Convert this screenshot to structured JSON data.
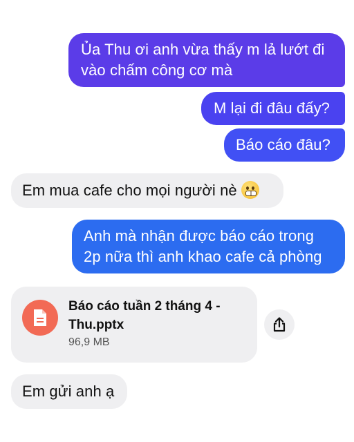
{
  "messages": [
    {
      "id": "m1",
      "direction": "outgoing",
      "text": "Ủa Thu ơi anh vừa thấy m lả lướt đi vào chấm công cơ mà"
    },
    {
      "id": "m2",
      "direction": "outgoing",
      "text": "M lại đi đâu đấy?"
    },
    {
      "id": "m3",
      "direction": "outgoing",
      "text": "Báo cáo đâu?"
    },
    {
      "id": "m4",
      "direction": "incoming",
      "text": "Em mua cafe cho mọi người nè",
      "emoji": "grimacing-face-icon"
    },
    {
      "id": "m5",
      "direction": "outgoing",
      "text": "Anh mà nhận được báo cáo trong 2p nữa thì anh khao cafe cả phòng"
    },
    {
      "id": "m7",
      "direction": "incoming",
      "text": "Em gửi anh ạ"
    }
  ],
  "attachment": {
    "file_name": "Báo cáo tuần 2 tháng 4 - Thu.pptx",
    "file_size": "96,9 MB",
    "icon": "document-icon",
    "action_icon": "share-icon"
  },
  "colors": {
    "outgoing_top": "#5b3ce8",
    "outgoing_mid": "#4150f4",
    "outgoing_bottom": "#2c6cf0",
    "incoming_bg": "#efeff1",
    "file_icon_bg": "#f26a55"
  }
}
